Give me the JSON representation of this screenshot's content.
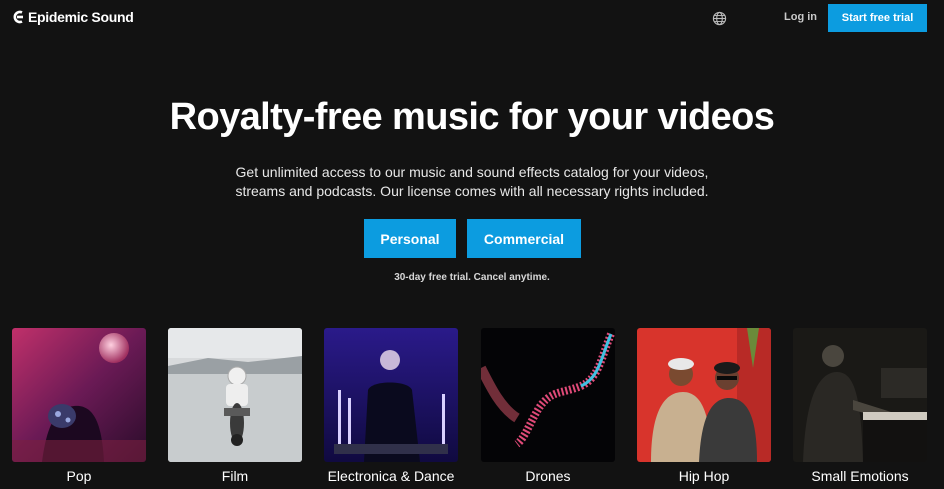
{
  "header": {
    "brand": "Epidemic Sound",
    "login_label": "Log in",
    "trial_label": "Start free trial"
  },
  "hero": {
    "title": "Royalty-free music for your videos",
    "subtitle_line1": "Get unlimited access to our music and sound effects catalog for your videos,",
    "subtitle_line2": "streams and podcasts. Our license comes with all necessary rights included.",
    "personal_label": "Personal",
    "commercial_label": "Commercial",
    "note": "30-day free trial. Cancel anytime."
  },
  "genres": [
    {
      "label": "Pop"
    },
    {
      "label": "Film"
    },
    {
      "label": "Electronica & Dance"
    },
    {
      "label": "Drones"
    },
    {
      "label": "Hip Hop"
    },
    {
      "label": "Small Emotions"
    }
  ],
  "colors": {
    "background": "#121212",
    "accent": "#0c9ce0"
  }
}
